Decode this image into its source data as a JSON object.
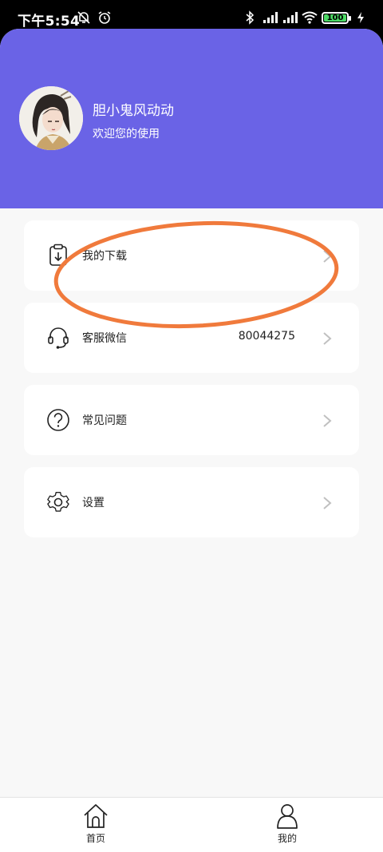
{
  "status_bar": {
    "time": "下午5:54",
    "battery": "100"
  },
  "profile": {
    "name": "胆小鬼风动动",
    "subtitle": "欢迎您的使用"
  },
  "menu": [
    {
      "label": "我的下载",
      "value": "",
      "icon": "clipboard-icon"
    },
    {
      "label": "客服微信",
      "value": "80044275",
      "icon": "headset-icon"
    },
    {
      "label": "常见问题",
      "value": "",
      "icon": "question-icon"
    },
    {
      "label": "设置",
      "value": "",
      "icon": "gear-icon"
    }
  ],
  "tabs": [
    {
      "label": "首页",
      "icon": "home-icon"
    },
    {
      "label": "我的",
      "icon": "user-icon"
    }
  ],
  "colors": {
    "header": "#6a63e6",
    "annotation": "#f07a3c",
    "battery": "#4cd964"
  }
}
